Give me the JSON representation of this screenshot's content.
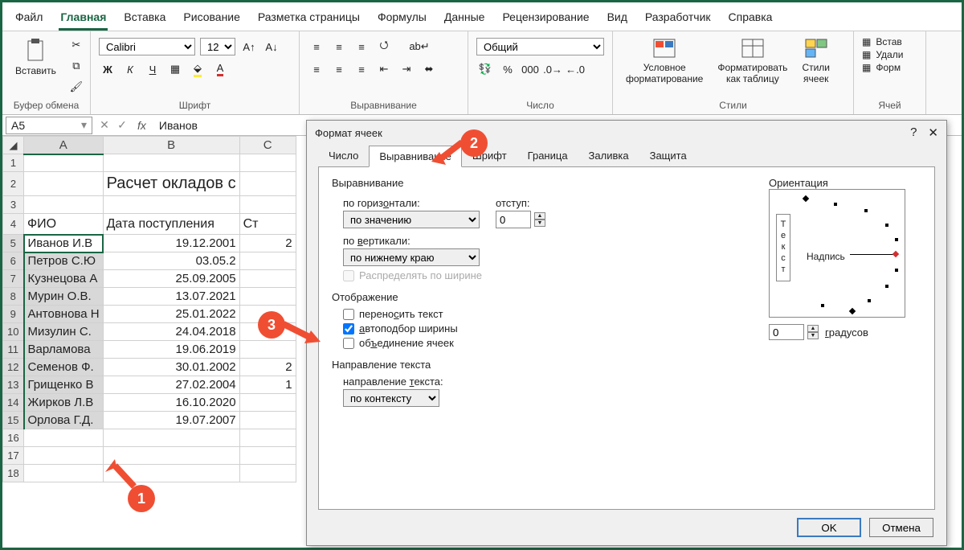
{
  "tabs": [
    "Файл",
    "Главная",
    "Вставка",
    "Рисование",
    "Разметка страницы",
    "Формулы",
    "Данные",
    "Рецензирование",
    "Вид",
    "Разработчик",
    "Справка"
  ],
  "activeTab": "Главная",
  "ribbon": {
    "clipboard": {
      "paste": "Вставить",
      "label": "Буфер обмена"
    },
    "font": {
      "name": "Calibri",
      "size": "12",
      "label": "Шрифт",
      "bold": "Ж",
      "italic": "К",
      "underline": "Ч"
    },
    "align": {
      "label": "Выравнивание"
    },
    "number": {
      "format": "Общий",
      "label": "Число"
    },
    "styles": {
      "cond": "Условное\nформатирование",
      "table": "Форматировать\nкак таблицу",
      "cell": "Стили\nячеек",
      "label": "Стили"
    },
    "cells": {
      "insert": "Встав",
      "delete": "Удали",
      "format": "Форм",
      "label": "Ячей"
    }
  },
  "namebox": "A5",
  "formula": "Иванов",
  "cols": [
    "A",
    "B",
    "C"
  ],
  "sheetTitle": "Расчет окладов с",
  "headers": {
    "a": "ФИО",
    "b": "Дата поступления",
    "c": "Ст"
  },
  "rows": [
    {
      "n": 5,
      "a": "Иванов И.В",
      "b": "19.12.2001",
      "c": "2"
    },
    {
      "n": 6,
      "a": "Петров С.Ю",
      "b": "03.05.2",
      "c": ""
    },
    {
      "n": 7,
      "a": "Кузнецова А",
      "b": "25.09.2005",
      "c": ""
    },
    {
      "n": 8,
      "a": "Мурин О.В.",
      "b": "13.07.2021",
      "c": ""
    },
    {
      "n": 9,
      "a": "Антовнова Н",
      "b": "25.01.2022",
      "c": ""
    },
    {
      "n": 10,
      "a": "Мизулин С.",
      "b": "24.04.2018",
      "c": ""
    },
    {
      "n": 11,
      "a": "Варламова",
      "b": "19.06.2019",
      "c": ""
    },
    {
      "n": 12,
      "a": "Семенов Ф.",
      "b": "30.01.2002",
      "c": "2"
    },
    {
      "n": 13,
      "a": "Грищенко В",
      "b": "27.02.2004",
      "c": "1"
    },
    {
      "n": 14,
      "a": "Жирков Л.В",
      "b": "16.10.2020",
      "c": ""
    },
    {
      "n": 15,
      "a": "Орлова Г.Д.",
      "b": "19.07.2007",
      "c": ""
    }
  ],
  "dialog": {
    "title": "Формат ячеек",
    "tabs": [
      "Число",
      "Выравнивание",
      "Шрифт",
      "Граница",
      "Заливка",
      "Защита"
    ],
    "activeTab": "Выравнивание",
    "align": {
      "group": "Выравнивание",
      "horiz": {
        "label": "по горизонтали:",
        "value": "по значению"
      },
      "indent": {
        "label": "отступ:",
        "value": "0"
      },
      "vert": {
        "label": "по вертикали:",
        "value": "по нижнему краю"
      },
      "justify": "Распределять по ширине"
    },
    "display": {
      "group": "Отображение",
      "wrap": "переносить текст",
      "shrink": "автоподбор ширины",
      "merge": "объединение ячеек"
    },
    "dir": {
      "group": "Направление текста",
      "label": "направление текста:",
      "value": "по контексту"
    },
    "orient": {
      "group": "Ориентация",
      "vtext": "Текст",
      "label": "Надпись",
      "degValue": "0",
      "degLabel": "градусов"
    },
    "ok": "OK",
    "cancel": "Отмена"
  },
  "markers": {
    "m1": "1",
    "m2": "2",
    "m3": "3"
  }
}
